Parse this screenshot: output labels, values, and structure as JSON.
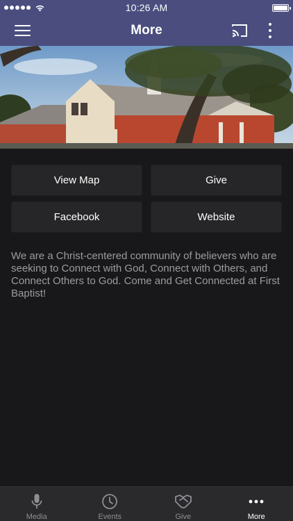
{
  "status_bar": {
    "time": "10:26 AM"
  },
  "nav": {
    "title": "More"
  },
  "actions": [
    {
      "label": "View Map"
    },
    {
      "label": "Give"
    },
    {
      "label": "Facebook"
    },
    {
      "label": "Website"
    }
  ],
  "description": "We are a Christ-centered community of believers who are seeking to Connect with God, Connect with Others, and Connect Others to God.  Come and Get Connected at First Baptist!",
  "tabs": [
    {
      "label": "Media",
      "icon": "microphone-icon"
    },
    {
      "label": "Events",
      "icon": "clock-icon"
    },
    {
      "label": "Give",
      "icon": "handshake-icon"
    },
    {
      "label": "More",
      "icon": "more-icon"
    }
  ],
  "colors": {
    "header": "#4a4d7e",
    "background": "#18181a",
    "button": "#262628",
    "text_muted": "#9c9ca0"
  }
}
